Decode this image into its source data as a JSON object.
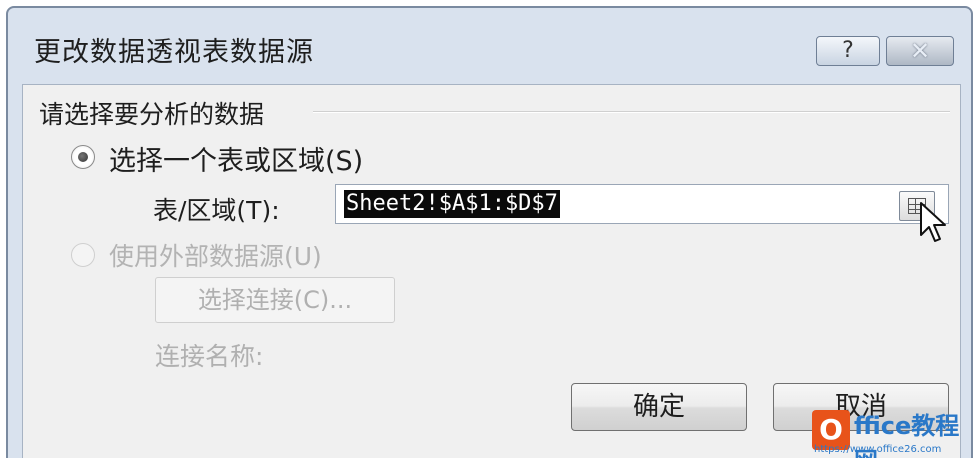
{
  "dialog": {
    "title": "更改数据透视表数据源",
    "help_label": "?",
    "close_label": "✕"
  },
  "group": {
    "title": "请选择要分析的数据"
  },
  "option_table": {
    "label": "选择一个表或区域(S)",
    "checked": true,
    "range_label": "表/区域(T):",
    "range_value": "Sheet2!$A$1:$D$7"
  },
  "option_external": {
    "label": "使用外部数据源(U)",
    "choose_connection_label": "选择连接(C)...",
    "connection_name_label": "连接名称:"
  },
  "buttons": {
    "ok_label": "确定",
    "cancel_label": "取消"
  },
  "watermark": {
    "logo_letter": "O",
    "title": "ffice教程网",
    "url": "https://www.office26.com"
  },
  "icons": {
    "help": "question-icon",
    "close": "close-icon",
    "collapse": "collapse-dialog-icon",
    "cursor": "mouse-pointer-icon"
  }
}
